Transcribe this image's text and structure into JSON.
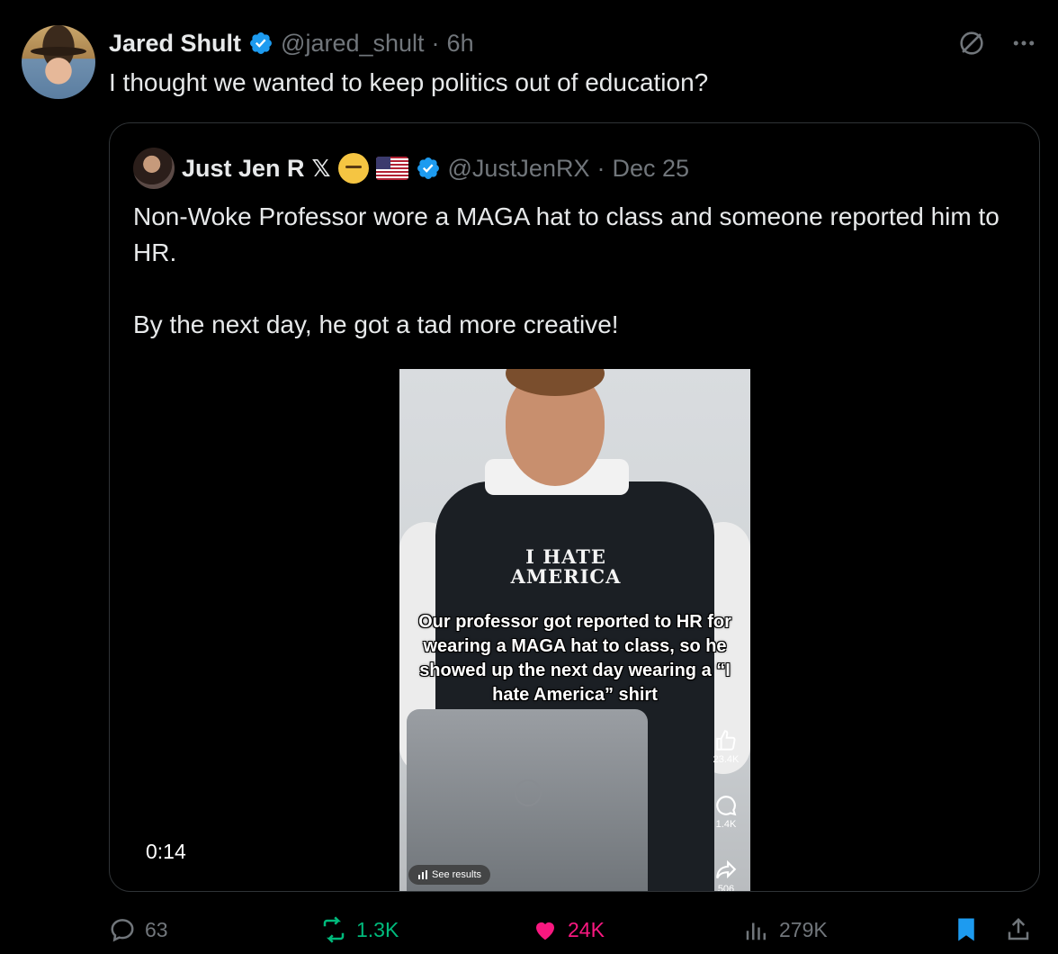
{
  "tweet": {
    "author_name": "Jared Shult",
    "author_handle": "@jared_shult",
    "separator": "·",
    "time": "6h",
    "text": "I thought we wanted to keep politics out of education?"
  },
  "quoted": {
    "author_name": "Just Jen R",
    "x_logo": "𝕏",
    "author_handle": "@JustJenRX",
    "separator": "·",
    "date": "Dec 25",
    "text": "Non-Woke Professor wore a MAGA hat to class and someone reported him to HR.\n\nBy the next day, he got a tad more creative!",
    "video": {
      "shirt_line1": "I HATE",
      "shirt_line2": "AMERICA",
      "caption": "Our professor got reported to HR for wearing a MAGA hat to class, so he showed up the next day wearing a “I hate America” shirt",
      "likes": "23.4K",
      "comments": "1.4K",
      "shares": "506",
      "see_results": "See results",
      "duration": "0:14"
    }
  },
  "actions": {
    "replies": "63",
    "retweets": "1.3K",
    "likes": "24K",
    "views": "279K"
  },
  "colors": {
    "accent_blue": "#1d9bf0",
    "retweet_green": "#00ba7c",
    "like_pink": "#f91880",
    "muted": "#71767b"
  },
  "icons": [
    "grok-icon",
    "more-icon",
    "verified-badge-icon",
    "reply-icon",
    "retweet-icon",
    "like-icon",
    "views-icon",
    "bookmark-icon",
    "share-icon"
  ]
}
